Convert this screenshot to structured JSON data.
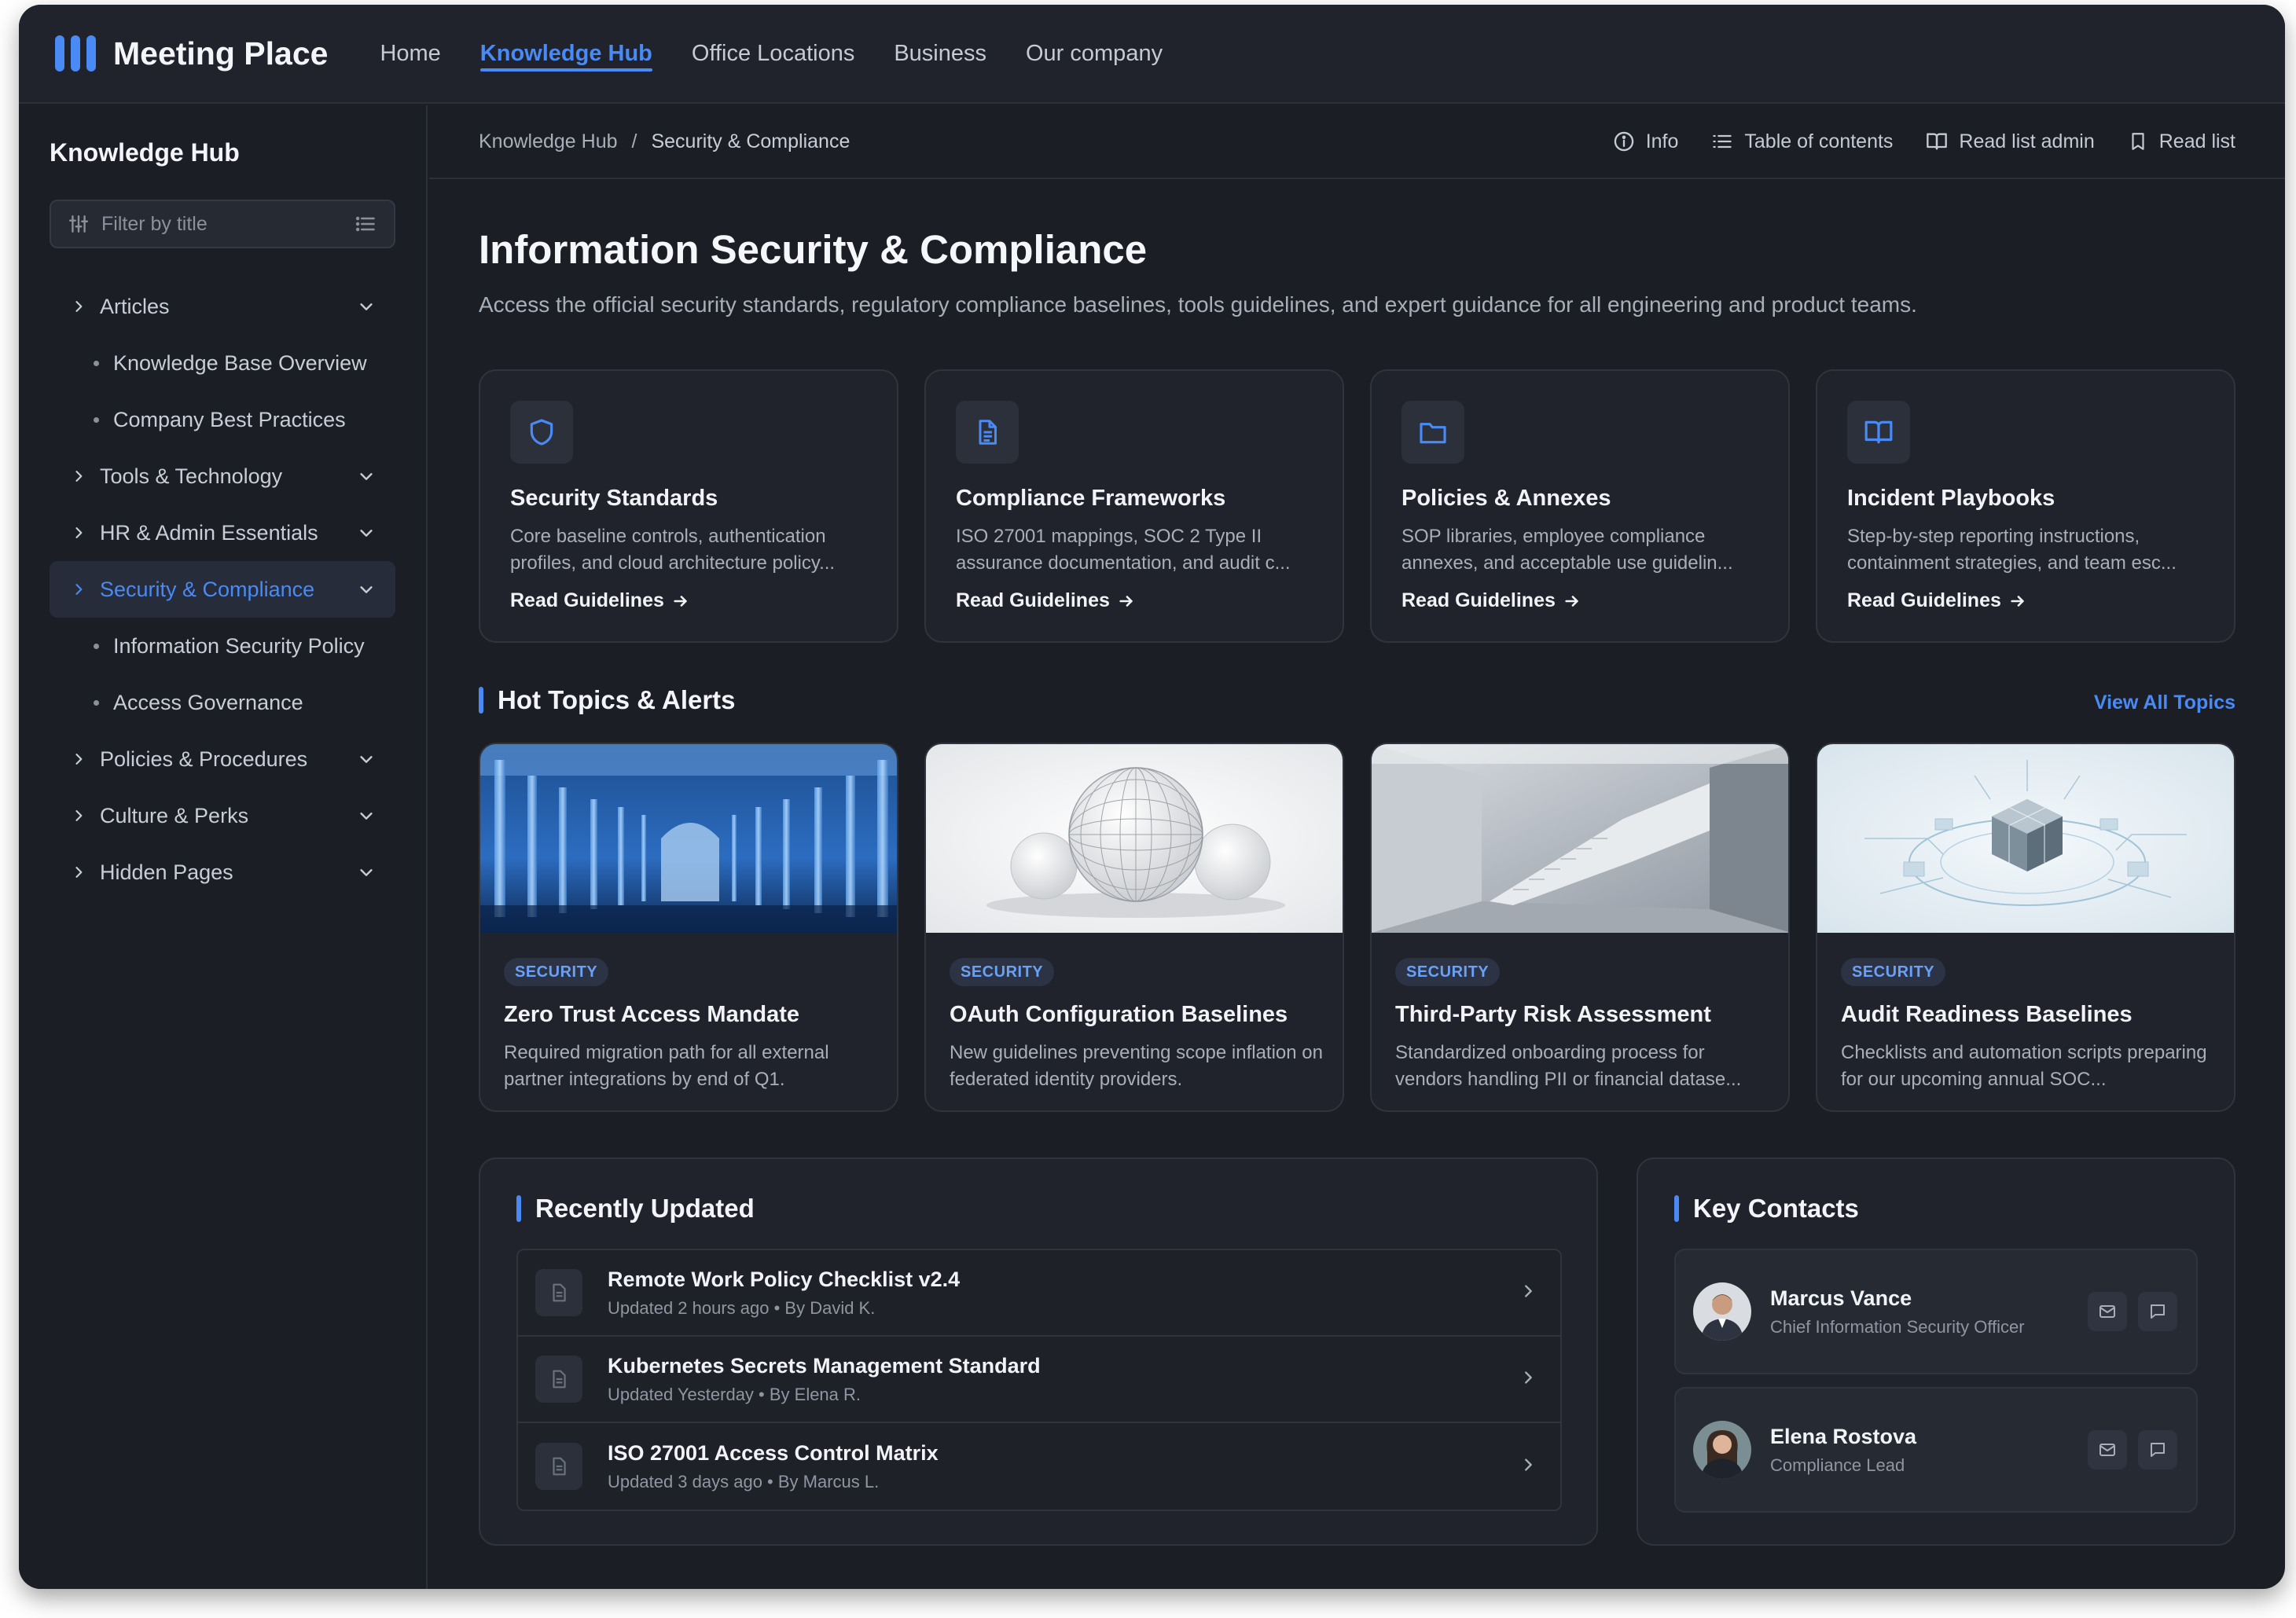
{
  "app": {
    "name": "Meeting Place",
    "brand_color": "#4a8af4",
    "background": "#1b1e25"
  },
  "nav": {
    "items": [
      {
        "label": "Home",
        "active": false
      },
      {
        "label": "Knowledge Hub",
        "active": true
      },
      {
        "label": "Office Locations",
        "active": false
      },
      {
        "label": "Business",
        "active": false
      },
      {
        "label": "Our company",
        "active": false
      }
    ]
  },
  "sidebar": {
    "title": "Knowledge Hub",
    "filter_placeholder": "Filter by title",
    "items": [
      {
        "label": "Articles",
        "type": "group",
        "active": false
      },
      {
        "label": "Knowledge Base Overview",
        "type": "sub"
      },
      {
        "label": "Company Best Practices",
        "type": "sub"
      },
      {
        "label": "Tools & Technology",
        "type": "group",
        "active": false
      },
      {
        "label": "HR & Admin Essentials",
        "type": "group",
        "active": false
      },
      {
        "label": "Security & Compliance",
        "type": "group",
        "active": true
      },
      {
        "label": "Information Security Policy",
        "type": "sub"
      },
      {
        "label": "Access Governance",
        "type": "sub"
      },
      {
        "label": "Policies & Procedures",
        "type": "group",
        "active": false
      },
      {
        "label": "Culture & Perks",
        "type": "group",
        "active": false
      },
      {
        "label": "Hidden Pages",
        "type": "group",
        "active": false
      }
    ]
  },
  "breadcrumb": {
    "root": "Knowledge Hub",
    "separator": "/",
    "current": "Security & Compliance"
  },
  "actions": {
    "info": "Info",
    "toc": "Table of contents",
    "read_list_admin": "Read list admin",
    "read_list": "Read list"
  },
  "page": {
    "title": "Information Security & Compliance",
    "subtitle": "Access the official security standards, regulatory compliance baselines, tools guidelines, and expert guidance for all engineering and product teams."
  },
  "categories": [
    {
      "icon": "shield-icon",
      "title": "Security Standards",
      "desc": "Core baseline controls, authentication profiles, and cloud architecture policy...",
      "link": "Read Guidelines"
    },
    {
      "icon": "document-icon",
      "title": "Compliance Frameworks",
      "desc": "ISO 27001 mappings, SOC 2 Type II assurance documentation, and audit c...",
      "link": "Read Guidelines"
    },
    {
      "icon": "folder-icon",
      "title": "Policies & Annexes",
      "desc": "SOP libraries, employee compliance annexes, and acceptable use guidelin...",
      "link": "Read Guidelines"
    },
    {
      "icon": "book-icon",
      "title": "Incident Playbooks",
      "desc": "Step-by-step reporting instructions, containment strategies, and team esc...",
      "link": "Read Guidelines"
    }
  ],
  "hot_topics": {
    "heading": "Hot Topics & Alerts",
    "view_all": "View All Topics",
    "items": [
      {
        "badge": "SECURITY",
        "title": "Zero Trust Access Mandate",
        "desc": "Required migration path for all external partner integrations by end of Q1.",
        "image": "blue-glass-pillars"
      },
      {
        "badge": "SECURITY",
        "title": "OAuth Configuration Baselines",
        "desc": "New guidelines preventing scope inflation on federated identity providers.",
        "image": "wireframe-spheres"
      },
      {
        "badge": "SECURITY",
        "title": "Third-Party Risk Assessment",
        "desc": "Standardized onboarding process for vendors handling PII or financial datase...",
        "image": "concrete-staircase"
      },
      {
        "badge": "SECURITY",
        "title": "Audit Readiness Baselines",
        "desc": "Checklists and automation scripts preparing for our upcoming annual SOC...",
        "image": "circuit-cube"
      }
    ]
  },
  "recently_updated": {
    "heading": "Recently Updated",
    "items": [
      {
        "title": "Remote Work Policy Checklist v2.4",
        "meta": "Updated 2 hours ago • By David K."
      },
      {
        "title": "Kubernetes Secrets Management Standard",
        "meta": "Updated Yesterday • By Elena R."
      },
      {
        "title": "ISO 27001 Access Control Matrix",
        "meta": "Updated 3 days ago • By Marcus L."
      }
    ]
  },
  "key_contacts": {
    "heading": "Key Contacts",
    "items": [
      {
        "name": "Marcus Vance",
        "role": "Chief Information Security Officer"
      },
      {
        "name": "Elena Rostova",
        "role": "Compliance Lead"
      }
    ]
  }
}
